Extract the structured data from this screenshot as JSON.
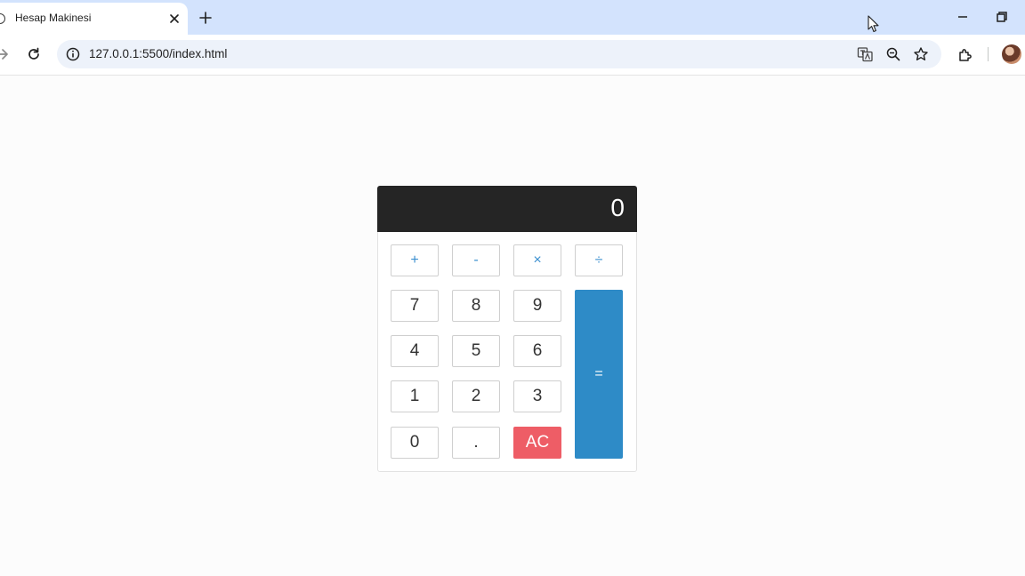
{
  "browser": {
    "tab_title": "Hesap Makinesi",
    "url": "127.0.0.1:5500/index.html"
  },
  "calculator": {
    "display": "0",
    "operators": [
      "+",
      "-",
      "×",
      "÷"
    ],
    "digits": [
      "7",
      "8",
      "9",
      "4",
      "5",
      "6",
      "1",
      "2",
      "3",
      "0"
    ],
    "decimal": ".",
    "clear": "AC",
    "equals": "=",
    "colors": {
      "display_bg": "#252525",
      "equals_bg": "#2e8bc7",
      "clear_bg": "#ee5d66",
      "operator_text": "#3a8fcf"
    }
  }
}
